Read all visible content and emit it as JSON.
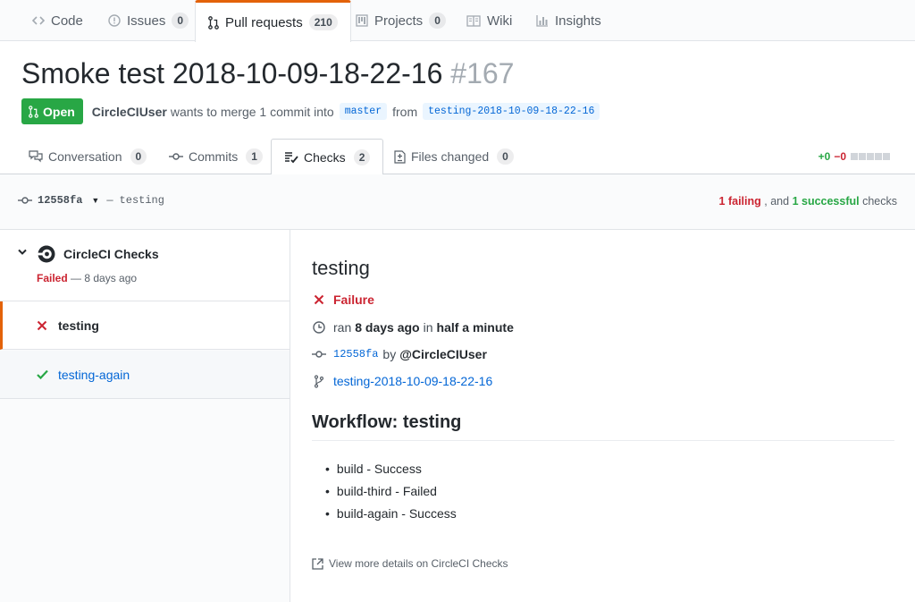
{
  "repo_tabs": [
    {
      "label": "Code",
      "count": null,
      "icon": "code-icon"
    },
    {
      "label": "Issues",
      "count": "0",
      "icon": "issue-opened-icon"
    },
    {
      "label": "Pull requests",
      "count": "210",
      "icon": "git-pull-request-icon"
    },
    {
      "label": "Projects",
      "count": "0",
      "icon": "project-icon"
    },
    {
      "label": "Wiki",
      "count": null,
      "icon": "book-icon"
    },
    {
      "label": "Insights",
      "count": null,
      "icon": "graph-icon"
    }
  ],
  "pr": {
    "title": "Smoke test 2018-10-09-18-22-16",
    "number": "#167",
    "state": "Open",
    "author": "CircleCIUser",
    "merge_text": "wants to merge 1 commit into",
    "base": "master",
    "from_text": "from",
    "head": "testing-2018-10-09-18-22-16"
  },
  "pr_tabs": [
    {
      "label": "Conversation",
      "count": "0",
      "icon": "comment-discussion-icon"
    },
    {
      "label": "Commits",
      "count": "1",
      "icon": "git-commit-icon"
    },
    {
      "label": "Checks",
      "count": "2",
      "icon": "checklist-icon"
    },
    {
      "label": "Files changed",
      "count": "0",
      "icon": "diff-icon"
    }
  ],
  "diffstat": {
    "added": "+0",
    "removed": "−0"
  },
  "commit_bar": {
    "sha": "12558fa",
    "separator": "—",
    "message": "testing",
    "failing_count": "1 failing",
    "middle": ", and",
    "success_count": "1 successful",
    "suffix": "checks"
  },
  "suite": {
    "name": "CircleCI Checks",
    "status": "Failed",
    "time": "— 8 days ago",
    "runs": [
      {
        "name": "testing",
        "status": "failure"
      },
      {
        "name": "testing-again",
        "status": "success"
      }
    ]
  },
  "detail": {
    "name": "testing",
    "conclusion": "Failure",
    "ran_prefix": "ran",
    "ran_when": "8 days ago",
    "ran_in": "in",
    "ran_duration": "half a minute",
    "commit_sha": "12558fa",
    "by": "by",
    "user": "@CircleCIUser",
    "branch": "testing-2018-10-09-18-22-16",
    "workflow_title": "Workflow: testing",
    "jobs": [
      "build - Success",
      "build-third - Failed",
      "build-again - Success"
    ],
    "more_link": "View more details on CircleCI Checks"
  },
  "colors": {
    "accent": "#e36209",
    "success": "#28a745",
    "failure": "#cb2431",
    "link": "#0366d6"
  }
}
